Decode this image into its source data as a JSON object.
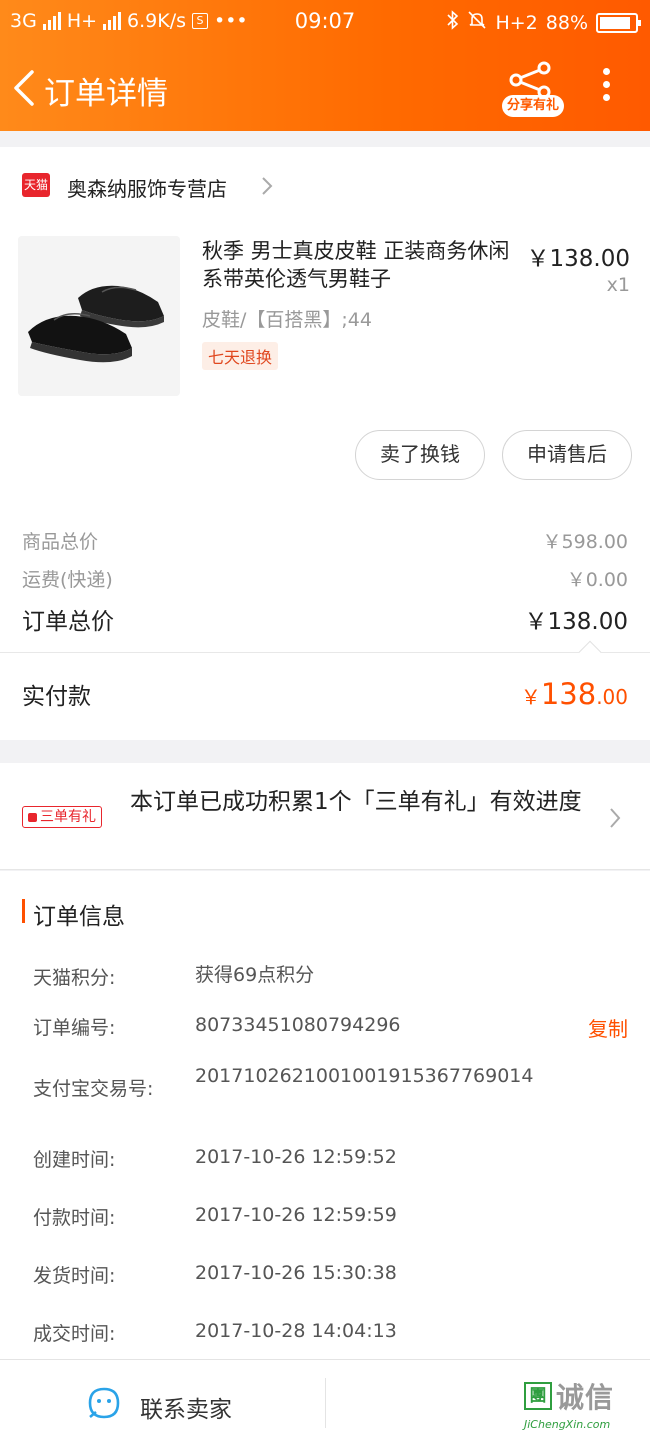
{
  "status_bar": {
    "net1": "3G",
    "net2": "H+",
    "speed": "6.9K/s",
    "time": "09:07",
    "net3": "H+2",
    "battery": "88%"
  },
  "header": {
    "title": "订单详情",
    "share_label": "分享有礼"
  },
  "shop": {
    "logo_text": "天猫",
    "name": "奥森纳服饰专营店"
  },
  "product": {
    "name": "秋季 男士真皮皮鞋 正装商务休闲系带英伦透气男鞋子",
    "price": "￥138.00",
    "qty": "x1",
    "sku": "皮鞋/【百搭黑】;44",
    "tag": "七天退换"
  },
  "actions": {
    "sell_label": "卖了换钱",
    "after_sale_label": "申请售后"
  },
  "pricing": {
    "subtotal_label": "商品总价",
    "subtotal_value": "￥598.00",
    "shipping_label": "运费(快递)",
    "shipping_value": "￥0.00",
    "total_label": "订单总价",
    "total_value": "￥138.00",
    "paid_label": "实付款",
    "paid_currency": "￥",
    "paid_int": "138",
    "paid_dec": ".00"
  },
  "promo": {
    "tag": "三单有礼",
    "text": "本订单已成功积累1个「三单有礼」有效进度"
  },
  "order_info": {
    "title": "订单信息",
    "copy_label": "复制",
    "rows": [
      {
        "label": "天猫积分:",
        "value": "获得69点积分"
      },
      {
        "label": "订单编号:",
        "value": "80733451080794296"
      },
      {
        "label": "支付宝交易号:",
        "value": "2017102621001001915367769014"
      },
      {
        "label": "创建时间:",
        "value": "2017-10-26 12:59:52"
      },
      {
        "label": "付款时间:",
        "value": "2017-10-26 12:59:59"
      },
      {
        "label": "发货时间:",
        "value": "2017-10-26 15:30:38"
      },
      {
        "label": "成交时间:",
        "value": "2017-10-28 14:04:13"
      }
    ]
  },
  "bottom": {
    "contact_label": "联系卖家"
  },
  "watermark": {
    "box": "團",
    "text": "诚信",
    "url": "JiChengXin.com"
  },
  "colors": {
    "header_start": "#ff8a1a",
    "header_end": "#ff5a00",
    "accent": "#ff5000",
    "tmall_red": "#e8262d"
  }
}
